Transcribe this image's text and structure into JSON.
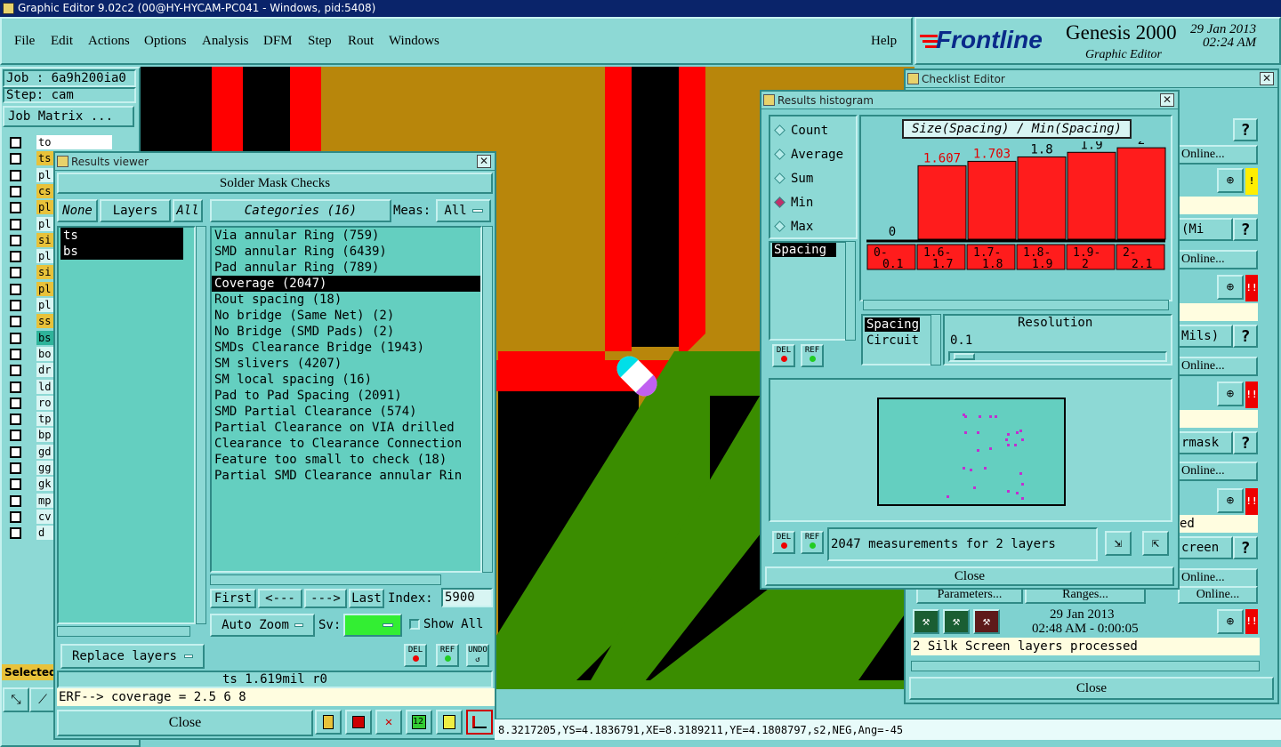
{
  "app": {
    "title": "Graphic Editor 9.02c2 (00@HY-HYCAM-PC041 - Windows, pid:5408)"
  },
  "menu": {
    "items": [
      "File",
      "Edit",
      "Actions",
      "Options",
      "Analysis",
      "DFM",
      "Step",
      "Rout",
      "Windows"
    ],
    "help": "Help"
  },
  "brand": {
    "logo": "Frontline",
    "product": "Genesis 2000",
    "subtitle": "Graphic Editor",
    "date": "29 Jan 2013",
    "time": "02:24 AM"
  },
  "left_panel": {
    "job": "Job : 6a9h200ia0",
    "step": "Step: cam",
    "job_matrix": "Job Matrix ...",
    "layers": [
      "to",
      "ts",
      "pl",
      "cs",
      "pl",
      "pl",
      "si",
      "pl",
      "si",
      "pl",
      "pl",
      "ss",
      "bs",
      "bo",
      "dr",
      "ld",
      "ro",
      "tp",
      "bp",
      "gd",
      "gg",
      "gk",
      "mp",
      "cv",
      "d"
    ],
    "selected_label": "Selected"
  },
  "results_viewer": {
    "title": "Results viewer",
    "heading": "Solder Mask Checks",
    "none": "None",
    "layers": "Layers",
    "all": "All",
    "categories": "Categories (16)",
    "meas_label": "Meas:",
    "meas_value": "All",
    "layer_list": [
      "ts",
      "bs"
    ],
    "category_list": [
      "Via annular Ring (759)",
      "SMD annular Ring (6439)",
      "Pad annular Ring (789)",
      "Coverage (2047)",
      "Rout spacing (18)",
      "No bridge (Same Net) (2)",
      "No Bridge (SMD Pads) (2)",
      "SMDs Clearance Bridge (1943)",
      "SM slivers (4207)",
      "SM local spacing (16)",
      "Pad to Pad Spacing (2091)",
      "SMD Partial Clearance (574)",
      "Partial Clearance on VIA drilled",
      "Clearance to Clearance Connection",
      "Feature too small to check (18)",
      "Partial SMD Clearance annular Rin"
    ],
    "first": "First",
    "prev": "<---",
    "next": "--->",
    "last": "Last",
    "index_label": "Index:",
    "index_value": "5900",
    "auto_zoom": "Auto Zoom",
    "sv_label": "Sv:",
    "show_all": "Show All",
    "replace_layers": "Replace layers",
    "del": "DEL",
    "ref": "REF",
    "undo": "UNDO",
    "info": "ts 1.619mil  r0",
    "erf": "ERF--> coverage = 2.5 6 8",
    "close": "Close"
  },
  "histogram": {
    "title": "Results histogram",
    "options": [
      "Count",
      "Average",
      "Sum",
      "Min",
      "Max"
    ],
    "selected_option": "Min",
    "chart_title": "Size(Spacing) / Min(Spacing)",
    "measure_list": [
      "Spacing"
    ],
    "param_list": [
      "Spacing",
      "Circuit"
    ],
    "resolution_label": "Resolution",
    "resolution_value": "0.1",
    "footer": "2047 measurements for 2 layers",
    "close": "Close",
    "del": "DEL",
    "ref": "REF"
  },
  "chart_data": {
    "type": "bar",
    "title": "Size(Spacing) / Min(Spacing)",
    "categories": [
      "0-0.1",
      "1.6-1.7",
      "1.7-1.8",
      "1.8-1.9",
      "1.9-2",
      "2-2.1"
    ],
    "values": [
      0,
      1.607,
      1.703,
      1.8,
      1.9,
      2
    ],
    "labels": [
      "0",
      "1.607",
      "1.703",
      "1.8",
      "1.9",
      "2"
    ],
    "ylim": [
      0,
      2.1
    ],
    "colors": {
      "bar": "#ff1c1c",
      "label_warn": "#e00000",
      "label_ok": "#000000"
    }
  },
  "checklist": {
    "title": "Checklist Editor",
    "rows": [
      "Online...",
      "(Mi",
      "Online...",
      "Mils)",
      "Online...",
      "rmask",
      "Online...",
      "ed",
      "creen",
      "Online..."
    ],
    "parameters": "Parameters...",
    "ranges": "Ranges...",
    "online": "Online...",
    "date": "29 Jan 2013",
    "time_range": "02:48 AM - 0:00:05",
    "status": "2 Silk Screen layers processed",
    "close": "Close",
    "warn1": "!",
    "warn2": "!!",
    "help": "?"
  },
  "statusbar": {
    "coords": "8.3217205,YS=4.1836791,XE=8.3189211,YE=4.1808797,s2,NEG,Ang=-45"
  }
}
